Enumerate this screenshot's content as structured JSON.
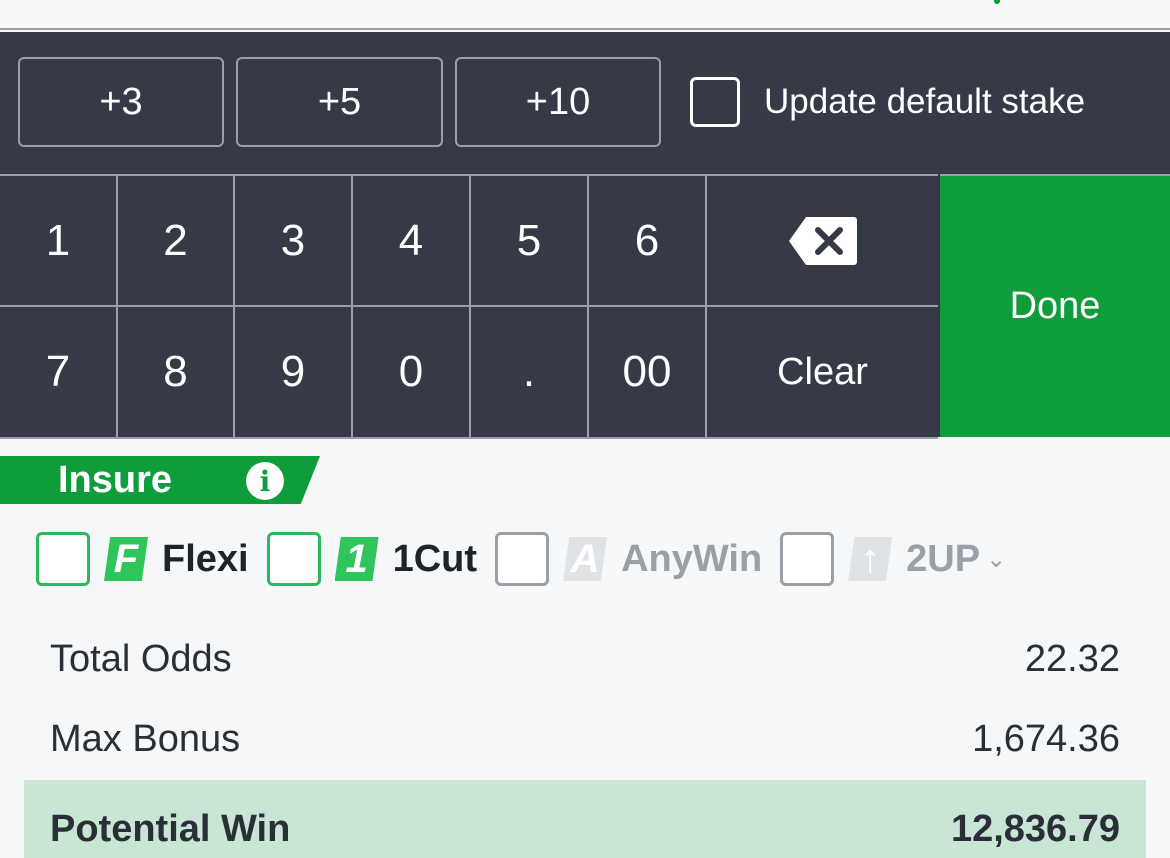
{
  "quick_add": [
    "+3",
    "+5",
    "+10"
  ],
  "update_default_stake": {
    "label": "Update default stake",
    "checked": false
  },
  "keypad": {
    "row1": [
      "1",
      "2",
      "3",
      "4",
      "5",
      "6"
    ],
    "row2": [
      "7",
      "8",
      "9",
      "0",
      ".",
      "00"
    ],
    "backspace_icon": "backspace-icon",
    "clear_label": "Clear",
    "done_label": "Done"
  },
  "insure": {
    "label": "Insure",
    "info_icon": "info-icon",
    "info_glyph": "i"
  },
  "options": [
    {
      "name": "flexi",
      "logo": "F",
      "label": "Flexi",
      "enabled": true
    },
    {
      "name": "1cut",
      "logo": "1",
      "label": "1Cut",
      "enabled": true
    },
    {
      "name": "anywin",
      "logo": "A",
      "label": "AnyWin",
      "enabled": false
    },
    {
      "name": "2up",
      "logo": "↑",
      "label": "2UP",
      "enabled": false
    }
  ],
  "summary": {
    "total_odds": {
      "label": "Total Odds",
      "value": "22.32"
    },
    "max_bonus": {
      "label": "Max Bonus",
      "value": "1,674.36"
    },
    "potential_win": {
      "label": "Potential Win",
      "value": "12,836.79"
    }
  },
  "colors": {
    "accent": "#0f9d3b",
    "keypad_bg": "#353a46",
    "highlight": "#c9e5d3"
  }
}
